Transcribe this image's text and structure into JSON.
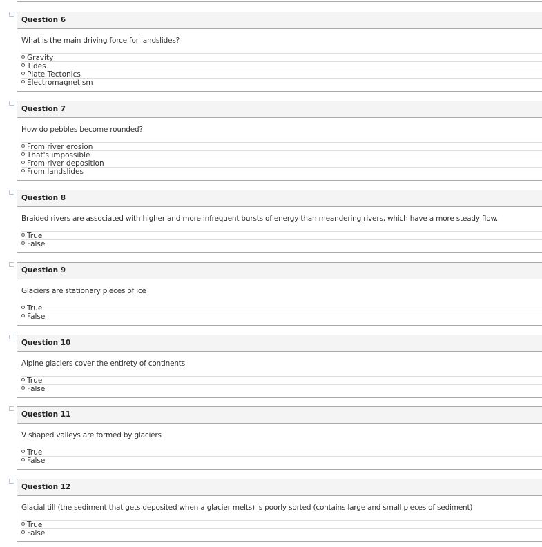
{
  "questions": [
    {
      "title": "Question 6",
      "text": "What is the main driving force for landslides?",
      "options": [
        "Gravity",
        "Tides",
        "Plate Tectonics",
        "Electromagnetism"
      ]
    },
    {
      "title": "Question 7",
      "text": "How do pebbles become rounded?",
      "options": [
        "From river erosion",
        "That's impossible",
        "From river deposition",
        "From landslides"
      ]
    },
    {
      "title": "Question 8",
      "text": "Braided rivers are associated with higher and more infrequent bursts of energy than meandering rivers, which have a more steady flow.",
      "options": [
        "True",
        "False"
      ]
    },
    {
      "title": "Question 9",
      "text": "Glaciers are stationary pieces of ice",
      "options": [
        "True",
        "False"
      ]
    },
    {
      "title": "Question 10",
      "text": "Alpine glaciers cover the entirety of continents",
      "options": [
        "True",
        "False"
      ]
    },
    {
      "title": "Question 11",
      "text": "V shaped valleys are formed by glaciers",
      "options": [
        "True",
        "False"
      ]
    },
    {
      "title": "Question 12",
      "text": "Glacial till (the sediment that gets deposited when a glacier melts) is poorly sorted (contains large and small pieces of sediment)",
      "options": [
        "True",
        "False"
      ]
    }
  ]
}
